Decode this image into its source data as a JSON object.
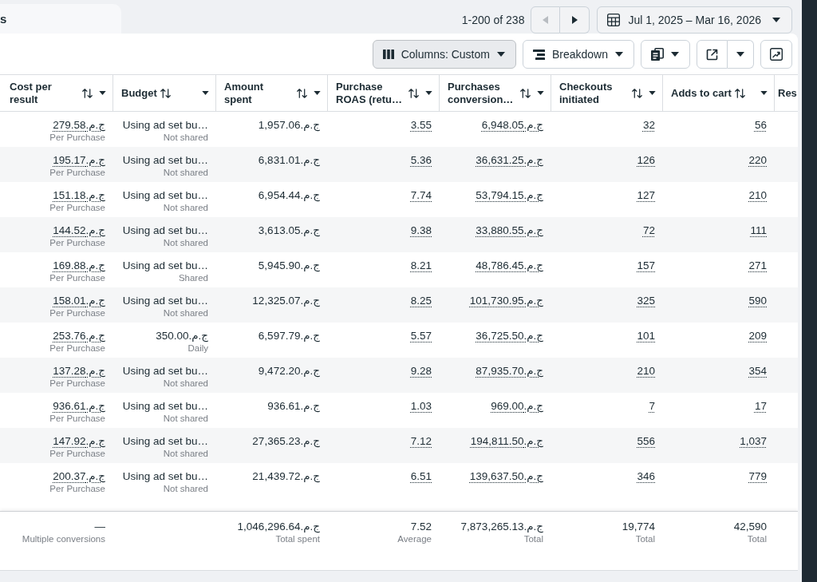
{
  "page_tab": {
    "label": "s"
  },
  "pagination": {
    "range": "1-200 of 238",
    "previous": {
      "disabled": true
    },
    "next": {
      "disabled": false
    }
  },
  "date_range": {
    "label": "Jul 1, 2025 – Mar 16, 2026"
  },
  "toolbar": {
    "columns": {
      "label": "Columns: Custom",
      "active": true
    },
    "breakdown": {
      "label": "Breakdown"
    }
  },
  "table": {
    "columns": [
      {
        "label": "Cost per result",
        "sortable": true,
        "menu": true,
        "dotted_values": true
      },
      {
        "label": "Budget",
        "sortable": true,
        "menu": true,
        "dotted_values": false
      },
      {
        "label": "Amount spent",
        "sortable": true,
        "menu": true,
        "dotted_values": false
      },
      {
        "label": "Purchase ROAS (retu…",
        "sortable": true,
        "menu": true,
        "dotted_values": true
      },
      {
        "label": "Purchases conversion…",
        "sortable": true,
        "menu": true,
        "dotted_values": true
      },
      {
        "label": "Checkouts initiated",
        "sortable": true,
        "menu": true,
        "dotted_values": true
      },
      {
        "label": "Adds to cart",
        "sortable": true,
        "menu": true,
        "dotted_values": true
      },
      {
        "label": "Res",
        "sortable": false,
        "menu": false
      }
    ],
    "rows": [
      {
        "cells": [
          {
            "value": "ج.م.279.58",
            "caption": "Per Purchase"
          },
          {
            "value": "Using ad set bu…",
            "caption": "Not shared"
          },
          {
            "value": "ج.م.1,957.06"
          },
          {
            "value": "3.55"
          },
          {
            "value": "ج.م.6,948.05"
          },
          {
            "value": "32"
          },
          {
            "value": "56"
          }
        ]
      },
      {
        "cells": [
          {
            "value": "ج.م.195.17",
            "caption": "Per Purchase"
          },
          {
            "value": "Using ad set bu…",
            "caption": "Not shared"
          },
          {
            "value": "ج.م.6,831.01"
          },
          {
            "value": "5.36"
          },
          {
            "value": "ج.م.36,631.25"
          },
          {
            "value": "126"
          },
          {
            "value": "220"
          }
        ]
      },
      {
        "cells": [
          {
            "value": "ج.م.151.18",
            "caption": "Per Purchase"
          },
          {
            "value": "Using ad set bu…",
            "caption": "Not shared"
          },
          {
            "value": "ج.م.6,954.44"
          },
          {
            "value": "7.74"
          },
          {
            "value": "ج.م.53,794.15"
          },
          {
            "value": "127"
          },
          {
            "value": "210"
          }
        ]
      },
      {
        "cells": [
          {
            "value": "ج.م.144.52",
            "caption": "Per Purchase"
          },
          {
            "value": "Using ad set bu…",
            "caption": "Not shared"
          },
          {
            "value": "ج.م.3,613.05"
          },
          {
            "value": "9.38"
          },
          {
            "value": "ج.م.33,880.55"
          },
          {
            "value": "72"
          },
          {
            "value": "111"
          }
        ]
      },
      {
        "cells": [
          {
            "value": "ج.م.169.88",
            "caption": "Per Purchase"
          },
          {
            "value": "Using ad set bu…",
            "caption": "Shared"
          },
          {
            "value": "ج.م.5,945.90"
          },
          {
            "value": "8.21"
          },
          {
            "value": "ج.م.48,786.45"
          },
          {
            "value": "157"
          },
          {
            "value": "271"
          }
        ]
      },
      {
        "cells": [
          {
            "value": "ج.م.158.01",
            "caption": "Per Purchase"
          },
          {
            "value": "Using ad set bu…",
            "caption": "Not shared"
          },
          {
            "value": "ج.م.12,325.07"
          },
          {
            "value": "8.25"
          },
          {
            "value": "ج.م.101,730.95"
          },
          {
            "value": "325"
          },
          {
            "value": "590"
          }
        ]
      },
      {
        "cells": [
          {
            "value": "ج.م.253.76",
            "caption": "Per Purchase"
          },
          {
            "value": "ج.م.350.00",
            "caption": "Daily"
          },
          {
            "value": "ج.م.6,597.79"
          },
          {
            "value": "5.57"
          },
          {
            "value": "ج.م.36,725.50"
          },
          {
            "value": "101"
          },
          {
            "value": "209"
          }
        ]
      },
      {
        "cells": [
          {
            "value": "ج.م.137.28",
            "caption": "Per Purchase"
          },
          {
            "value": "Using ad set bu…",
            "caption": "Not shared"
          },
          {
            "value": "ج.م.9,472.20"
          },
          {
            "value": "9.28"
          },
          {
            "value": "ج.م.87,935.70"
          },
          {
            "value": "210"
          },
          {
            "value": "354"
          }
        ]
      },
      {
        "cells": [
          {
            "value": "ج.م.936.61",
            "caption": "Per Purchase"
          },
          {
            "value": "Using ad set bu…",
            "caption": "Not shared"
          },
          {
            "value": "ج.م.936.61"
          },
          {
            "value": "1.03"
          },
          {
            "value": "ج.م.969.00"
          },
          {
            "value": "7"
          },
          {
            "value": "17"
          }
        ]
      },
      {
        "cells": [
          {
            "value": "ج.م.147.92",
            "caption": "Per Purchase"
          },
          {
            "value": "Using ad set bu…",
            "caption": "Not shared"
          },
          {
            "value": "ج.م.27,365.23"
          },
          {
            "value": "7.12"
          },
          {
            "value": "ج.م.194,811.50"
          },
          {
            "value": "556"
          },
          {
            "value": "1,037"
          }
        ]
      },
      {
        "cells": [
          {
            "value": "ج.م.200.37",
            "caption": "Per Purchase"
          },
          {
            "value": "Using ad set bu…",
            "caption": "Not shared"
          },
          {
            "value": "ج.م.21,439.72"
          },
          {
            "value": "6.51"
          },
          {
            "value": "ج.م.139,637.50"
          },
          {
            "value": "346"
          },
          {
            "value": "779"
          }
        ]
      }
    ],
    "summary_row": {
      "cells": [
        {
          "kind": "total",
          "value": "—",
          "caption": "Multiple conversions"
        },
        {
          "kind": "blank"
        },
        {
          "kind": "total",
          "value": "ج.م.1,046,296.64",
          "caption": "Total spent"
        },
        {
          "kind": "total",
          "value": "7.52",
          "caption": "Average"
        },
        {
          "kind": "total",
          "value": "ج.م.7,873,265.13",
          "caption": "Total"
        },
        {
          "kind": "total",
          "value": "19,774",
          "caption": "Total"
        },
        {
          "kind": "total",
          "value": "42,590",
          "caption": "Total"
        }
      ]
    }
  }
}
